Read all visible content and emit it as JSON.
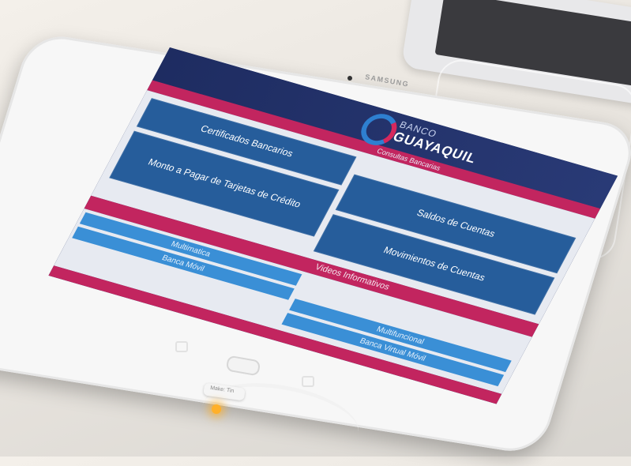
{
  "device": {
    "brand": "SAMSUNG",
    "connector_text": "Make: Tin"
  },
  "app": {
    "logo_line1": "BANCO",
    "logo_line2": "GUAYAQUIL",
    "subtitle": "Consultas Bancarias",
    "tiles": [
      "Certificados Bancarios",
      "Monto a Pagar de Tarjetas de Crédito",
      "Saldos de Cuentas",
      "Movimientos de Cuentas"
    ],
    "video_section": "Videos Informativos",
    "video_items": [
      "Multimatica",
      "Banca Móvil",
      "Multifuncional",
      "Banca Virtual Móvil"
    ]
  },
  "colors": {
    "navy": "#1f2f63",
    "pink": "#c2255f",
    "tile_blue": "#265d9b",
    "strip_blue": "#3a8fd6",
    "panel": "#e7eaf1"
  }
}
